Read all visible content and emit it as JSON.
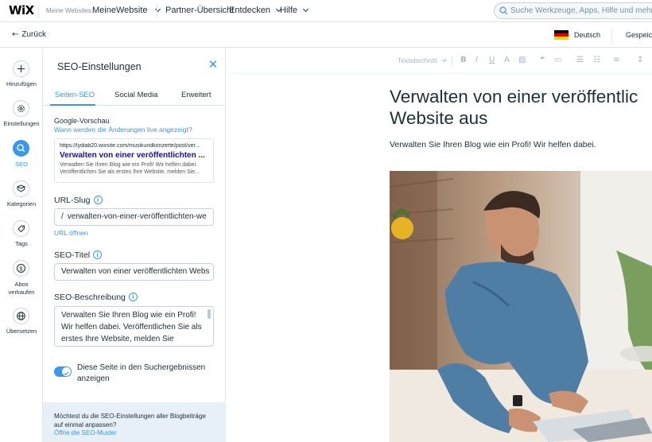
{
  "topbar": {
    "logo": "WiX",
    "site_label": "Meine Websites:",
    "site_name": "MeineWebsite",
    "nav": [
      "Partner-Übersicht",
      "Entdecken",
      "Hilfe"
    ],
    "search_placeholder": "Suche Werkzeuge, Apps, Hilfe und mehr"
  },
  "subbar": {
    "back_label": "Zurück",
    "language": "Deutsch",
    "saved_label": "Gespeich"
  },
  "rail": {
    "items": [
      {
        "label": "Hinzufügen",
        "icon": "plus-icon"
      },
      {
        "label": "Einstellungen",
        "icon": "gear-icon"
      },
      {
        "label": "SEO",
        "icon": "search-icon",
        "active": true
      },
      {
        "label": "Kategorien",
        "icon": "categories-icon"
      },
      {
        "label": "Tags",
        "icon": "tag-icon"
      },
      {
        "label": "Abos verkaufen",
        "label_line1": "Abos",
        "label_line2": "verkaufen",
        "icon": "dollar-icon"
      },
      {
        "label": "Übersetzen",
        "icon": "globe-icon"
      }
    ]
  },
  "panel": {
    "title": "SEO-Einstellungen",
    "tabs": [
      "Seiten-SEO",
      "Social Media",
      "Erweitert"
    ],
    "google_preview": {
      "label": "Google-Vorschau",
      "help_link": "Wann werden die Änderungen live angezeigt?",
      "url": "https://lydiab20.wixsite.com/musikundkonzerte/post/ver...",
      "title": "Verwalten von einer veröffentlichten ...",
      "description": "Verwalten Sie Ihren Blog wie ein Profi! Wir helfen dabei. Veröffentlichen Sie als erstes Ihre Website, melden Sie..."
    },
    "url_slug": {
      "label": "URL-Slug",
      "prefix": "/",
      "value": "verwalten-von-einer-veröffentlichten-we",
      "open_link": "URL öffnen"
    },
    "seo_title": {
      "label": "SEO-Titel",
      "value": "Verwalten von einer veröffentlichten Webs"
    },
    "seo_description": {
      "label": "SEO-Beschreibung",
      "value": "Verwalten Sie Ihren Blog wie ein Profi! Wir helfen dabei. Veröffentlichen Sie als erstes Ihre Website, melden Sie"
    },
    "toggle": {
      "label": "Diese Seite in den Suchergebnissen anzeigen",
      "on": true
    },
    "footer": {
      "text": "Möchtest du die SEO-Einstellungen aller Blogbeiträge auf einmal anpassen?",
      "link": "Öffne die SEO-Muster"
    }
  },
  "editor": {
    "toolbar": {
      "style_label": "Textabschnitt"
    },
    "post_title_line1": "Verwalten von einer veröffentlic",
    "post_title_line2": "Website aus",
    "post_subtitle": "Verwalten Sie Ihren Blog wie ein Profi! Wir helfen dabei."
  },
  "colors": {
    "accent": "#3899ec",
    "text": "#20303c",
    "panel_footer_bg": "#e7f0f7"
  }
}
